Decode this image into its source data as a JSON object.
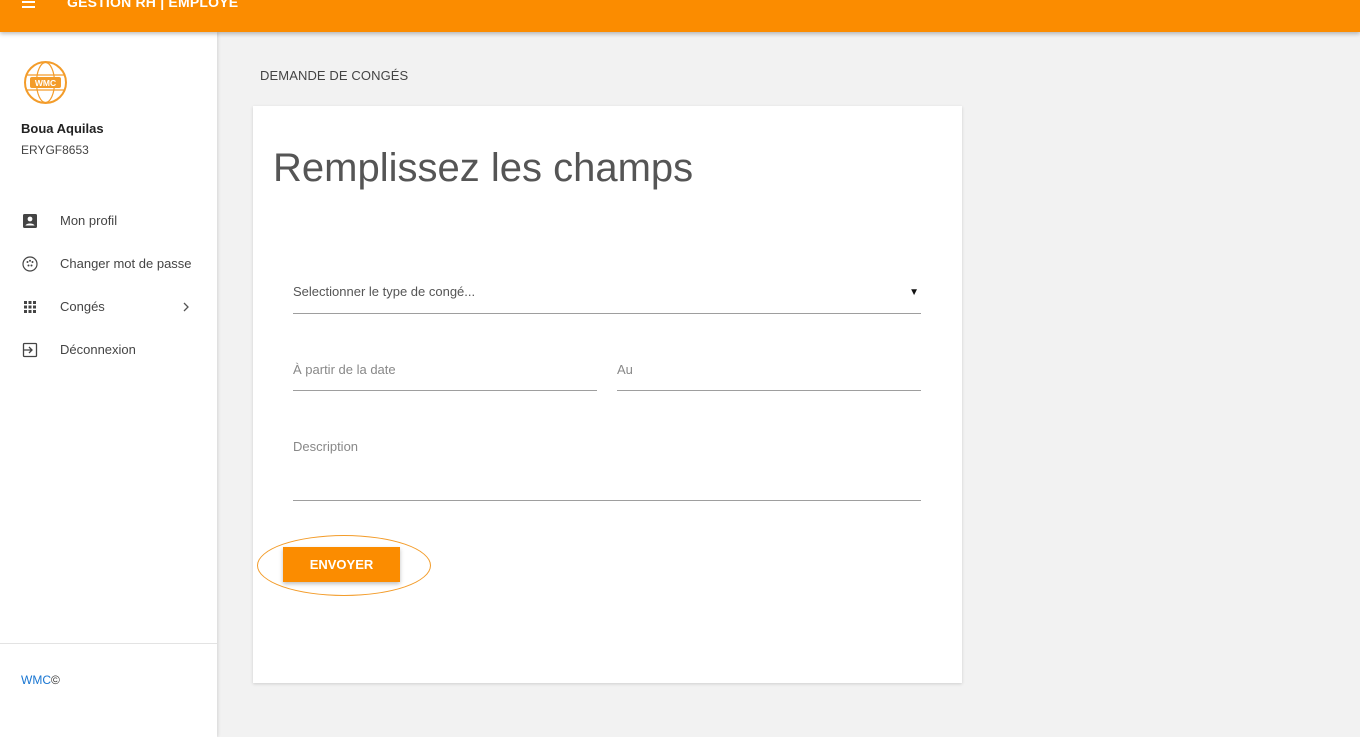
{
  "topbar": {
    "title": "GESTION RH | EMPLOYÉ",
    "menu_icon": "hamburger-icon",
    "color": "#fb8c00"
  },
  "sidebar": {
    "logo_text": "WMC",
    "user_name": "Boua Aquilas",
    "user_id": "ERYGF8653",
    "items": [
      {
        "label": "Mon profil",
        "icon": "account-box-icon"
      },
      {
        "label": "Changer mot de passe",
        "icon": "password-dots-icon"
      },
      {
        "label": "Congés",
        "icon": "apps-grid-icon",
        "has_submenu": true
      },
      {
        "label": "Déconnexion",
        "icon": "logout-icon"
      }
    ],
    "footer_brand": "WMC",
    "footer_copy": "©"
  },
  "main": {
    "breadcrumb": "DEMANDE DE CONGÉS",
    "form": {
      "title": "Remplissez les champs",
      "type_placeholder": "Selectionner le type de congé...",
      "date_from_label": "À partir de la date",
      "date_to_label": "Au",
      "description_label": "Description",
      "submit_label": "ENVOYER"
    }
  },
  "colors": {
    "accent": "#fb8c00",
    "link": "#1976d2",
    "background": "#f2f2f2"
  }
}
